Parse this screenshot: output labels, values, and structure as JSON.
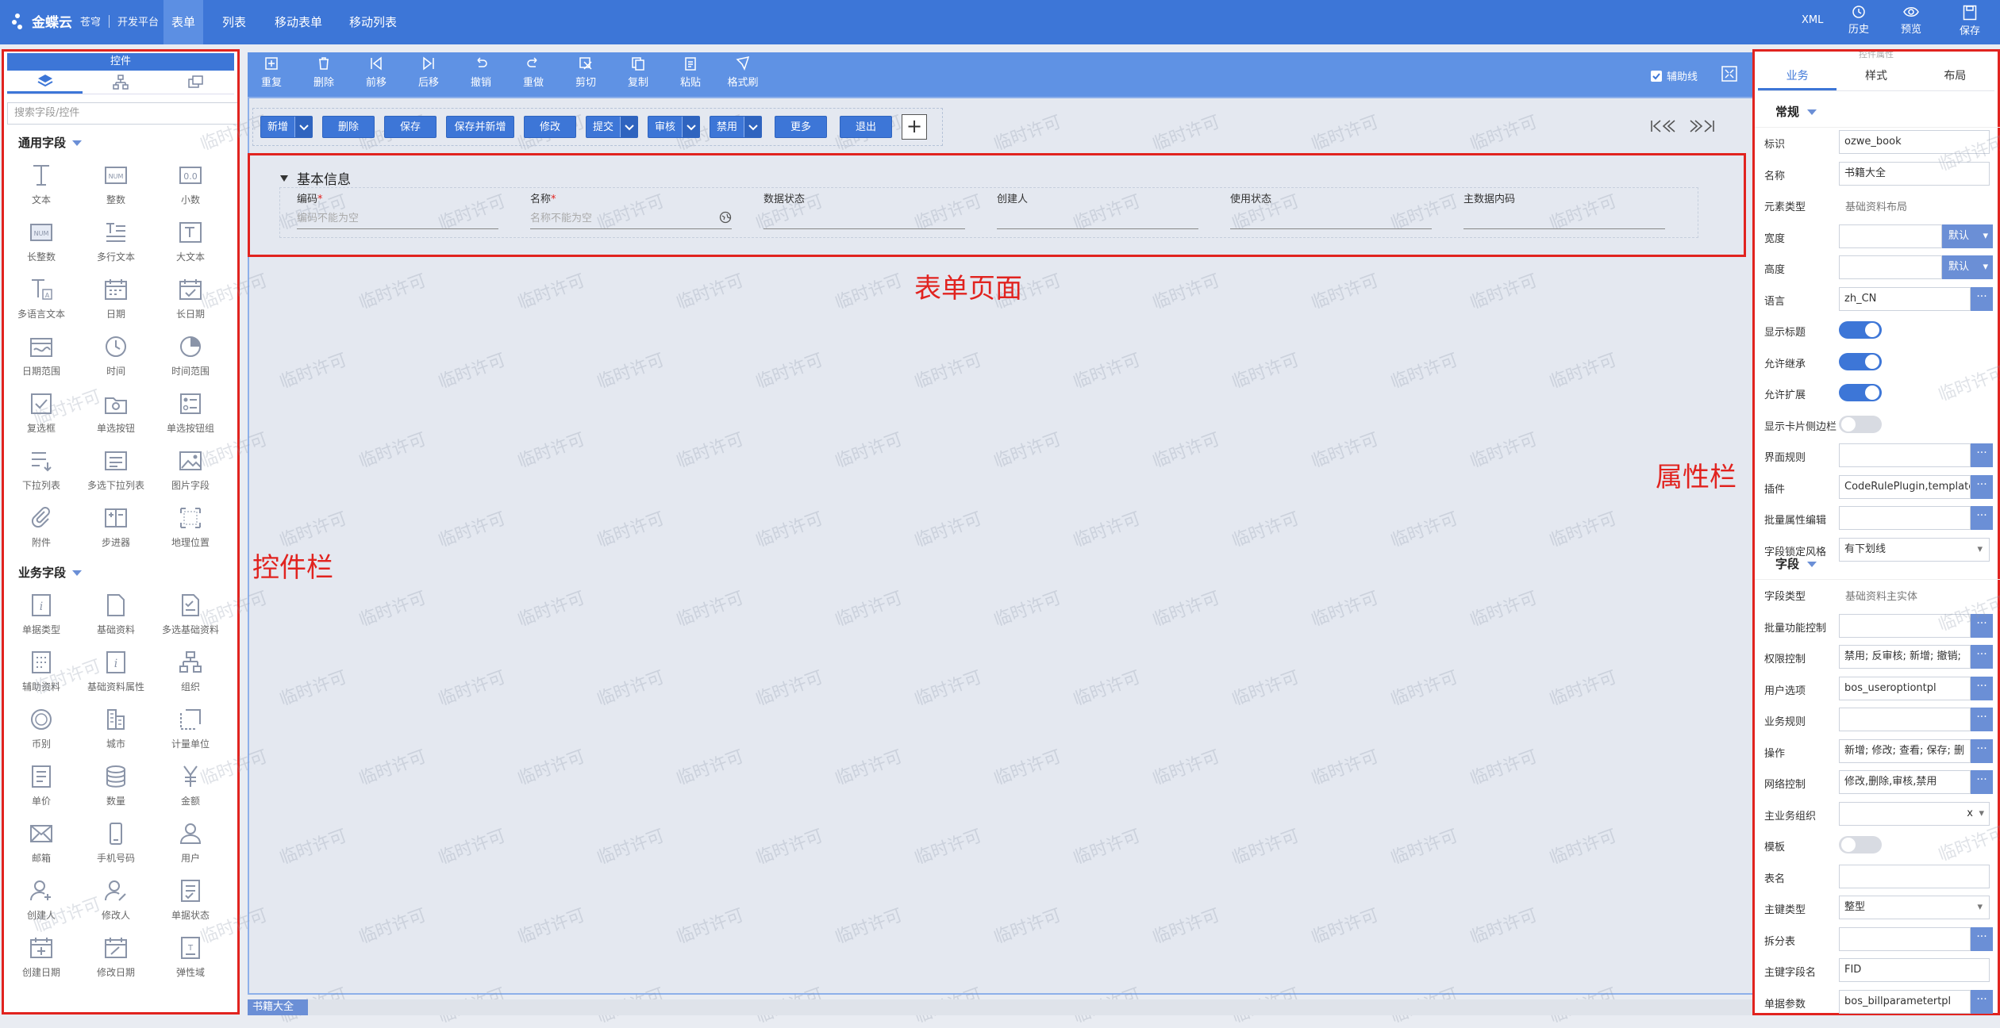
{
  "topbar": {
    "brand": "金蝶云",
    "brand_sub": "苍穹",
    "platform": "开发平台",
    "nav": [
      "表单",
      "列表",
      "移动表单",
      "移动列表"
    ],
    "xml_label": "XML",
    "history_label": "历史",
    "preview_label": "预览",
    "save_label": "保存"
  },
  "left_panel": {
    "title": "控件",
    "search_placeholder": "搜索字段/控件",
    "common_section": "通用字段",
    "common_fields": [
      "文本",
      "整数",
      "小数",
      "长整数",
      "多行文本",
      "大文本",
      "多语言文本",
      "日期",
      "长日期",
      "日期范围",
      "时间",
      "时间范围",
      "复选框",
      "单选按钮",
      "单选按钮组",
      "下拉列表",
      "多选下拉列表",
      "图片字段",
      "附件",
      "步进器",
      "地理位置"
    ],
    "business_section": "业务字段",
    "business_fields": [
      "单据类型",
      "基础资料",
      "多选基础资料",
      "辅助资料",
      "基础资料属性",
      "组织",
      "币别",
      "城市",
      "计量单位",
      "单价",
      "数量",
      "金额",
      "邮箱",
      "手机号码",
      "用户",
      "创建人",
      "修改人",
      "单据状态",
      "创建日期",
      "修改日期",
      "弹性域"
    ]
  },
  "toolbar": {
    "items": [
      "重复",
      "删除",
      "前移",
      "后移",
      "撤销",
      "重做",
      "剪切",
      "复制",
      "粘贴",
      "格式刷"
    ],
    "guide_label": "辅助线"
  },
  "form": {
    "buttons": [
      "新增",
      "删除",
      "保存",
      "保存并新增",
      "修改",
      "提交",
      "审核",
      "禁用",
      "更多",
      "退出"
    ],
    "add_symbol": "+",
    "group_title": "基本信息",
    "required_mark": "*",
    "fields": [
      {
        "label": "编码",
        "required": true,
        "placeholder": "编码不能为空"
      },
      {
        "label": "名称",
        "required": true,
        "placeholder": "名称不能为空"
      },
      {
        "label": "数据状态",
        "required": false,
        "placeholder": ""
      },
      {
        "label": "创建人",
        "required": false,
        "placeholder": ""
      },
      {
        "label": "使用状态",
        "required": false,
        "placeholder": ""
      },
      {
        "label": "主数据内码",
        "required": false,
        "placeholder": ""
      }
    ],
    "bottom_tab": "书籍大全"
  },
  "annotations": {
    "form_page": "表单页面",
    "controls_bar": "控件栏",
    "property_bar": "属性栏"
  },
  "watermark": "临时许可",
  "right_panel": {
    "header": "控件属性",
    "tabs": [
      "业务",
      "样式",
      "布局"
    ],
    "general_section": "常规",
    "field_section": "字段",
    "default_label": "默认",
    "more_symbol": "···",
    "clear_symbol": "x",
    "props_general": [
      {
        "label": "标识",
        "value": "ozwe_book",
        "kind": "input"
      },
      {
        "label": "名称",
        "value": "书籍大全",
        "kind": "input"
      },
      {
        "label": "元素类型",
        "value": "基础资料布局",
        "kind": "text"
      },
      {
        "label": "宽度",
        "value": "",
        "kind": "unit"
      },
      {
        "label": "高度",
        "value": "",
        "kind": "unit"
      },
      {
        "label": "语言",
        "value": "zh_CN",
        "kind": "more"
      },
      {
        "label": "显示标题",
        "value": "on",
        "kind": "toggle"
      },
      {
        "label": "允许继承",
        "value": "on",
        "kind": "toggle"
      },
      {
        "label": "允许扩展",
        "value": "on",
        "kind": "toggle"
      },
      {
        "label": "显示卡片侧边栏",
        "value": "off",
        "kind": "toggle"
      },
      {
        "label": "界面规则",
        "value": "",
        "kind": "more"
      },
      {
        "label": "插件",
        "value": "CodeRulePlugin,template",
        "kind": "more"
      },
      {
        "label": "批量属性编辑",
        "value": "",
        "kind": "more"
      },
      {
        "label": "字段锁定风格",
        "value": "有下划线",
        "kind": "select"
      }
    ],
    "props_field": [
      {
        "label": "字段类型",
        "value": "基础资料主实体",
        "kind": "text"
      },
      {
        "label": "批量功能控制",
        "value": "",
        "kind": "more"
      },
      {
        "label": "权限控制",
        "value": "禁用; 反审核; 新增; 撤销;",
        "kind": "more"
      },
      {
        "label": "用户选项",
        "value": "bos_useroptiontpl",
        "kind": "more"
      },
      {
        "label": "业务规则",
        "value": "",
        "kind": "more"
      },
      {
        "label": "操作",
        "value": "新增; 修改; 查看; 保存; 删",
        "kind": "more"
      },
      {
        "label": "网络控制",
        "value": "修改,删除,审核,禁用",
        "kind": "more"
      },
      {
        "label": "主业务组织",
        "value": "",
        "kind": "clear"
      },
      {
        "label": "模板",
        "value": "off",
        "kind": "toggle"
      },
      {
        "label": "表名",
        "value": "",
        "kind": "input"
      },
      {
        "label": "主键类型",
        "value": "整型",
        "kind": "select"
      },
      {
        "label": "拆分表",
        "value": "",
        "kind": "more"
      },
      {
        "label": "主键字段名",
        "value": "FID",
        "kind": "input"
      },
      {
        "label": "单据参数",
        "value": "bos_billparametertpl",
        "kind": "more"
      }
    ]
  }
}
